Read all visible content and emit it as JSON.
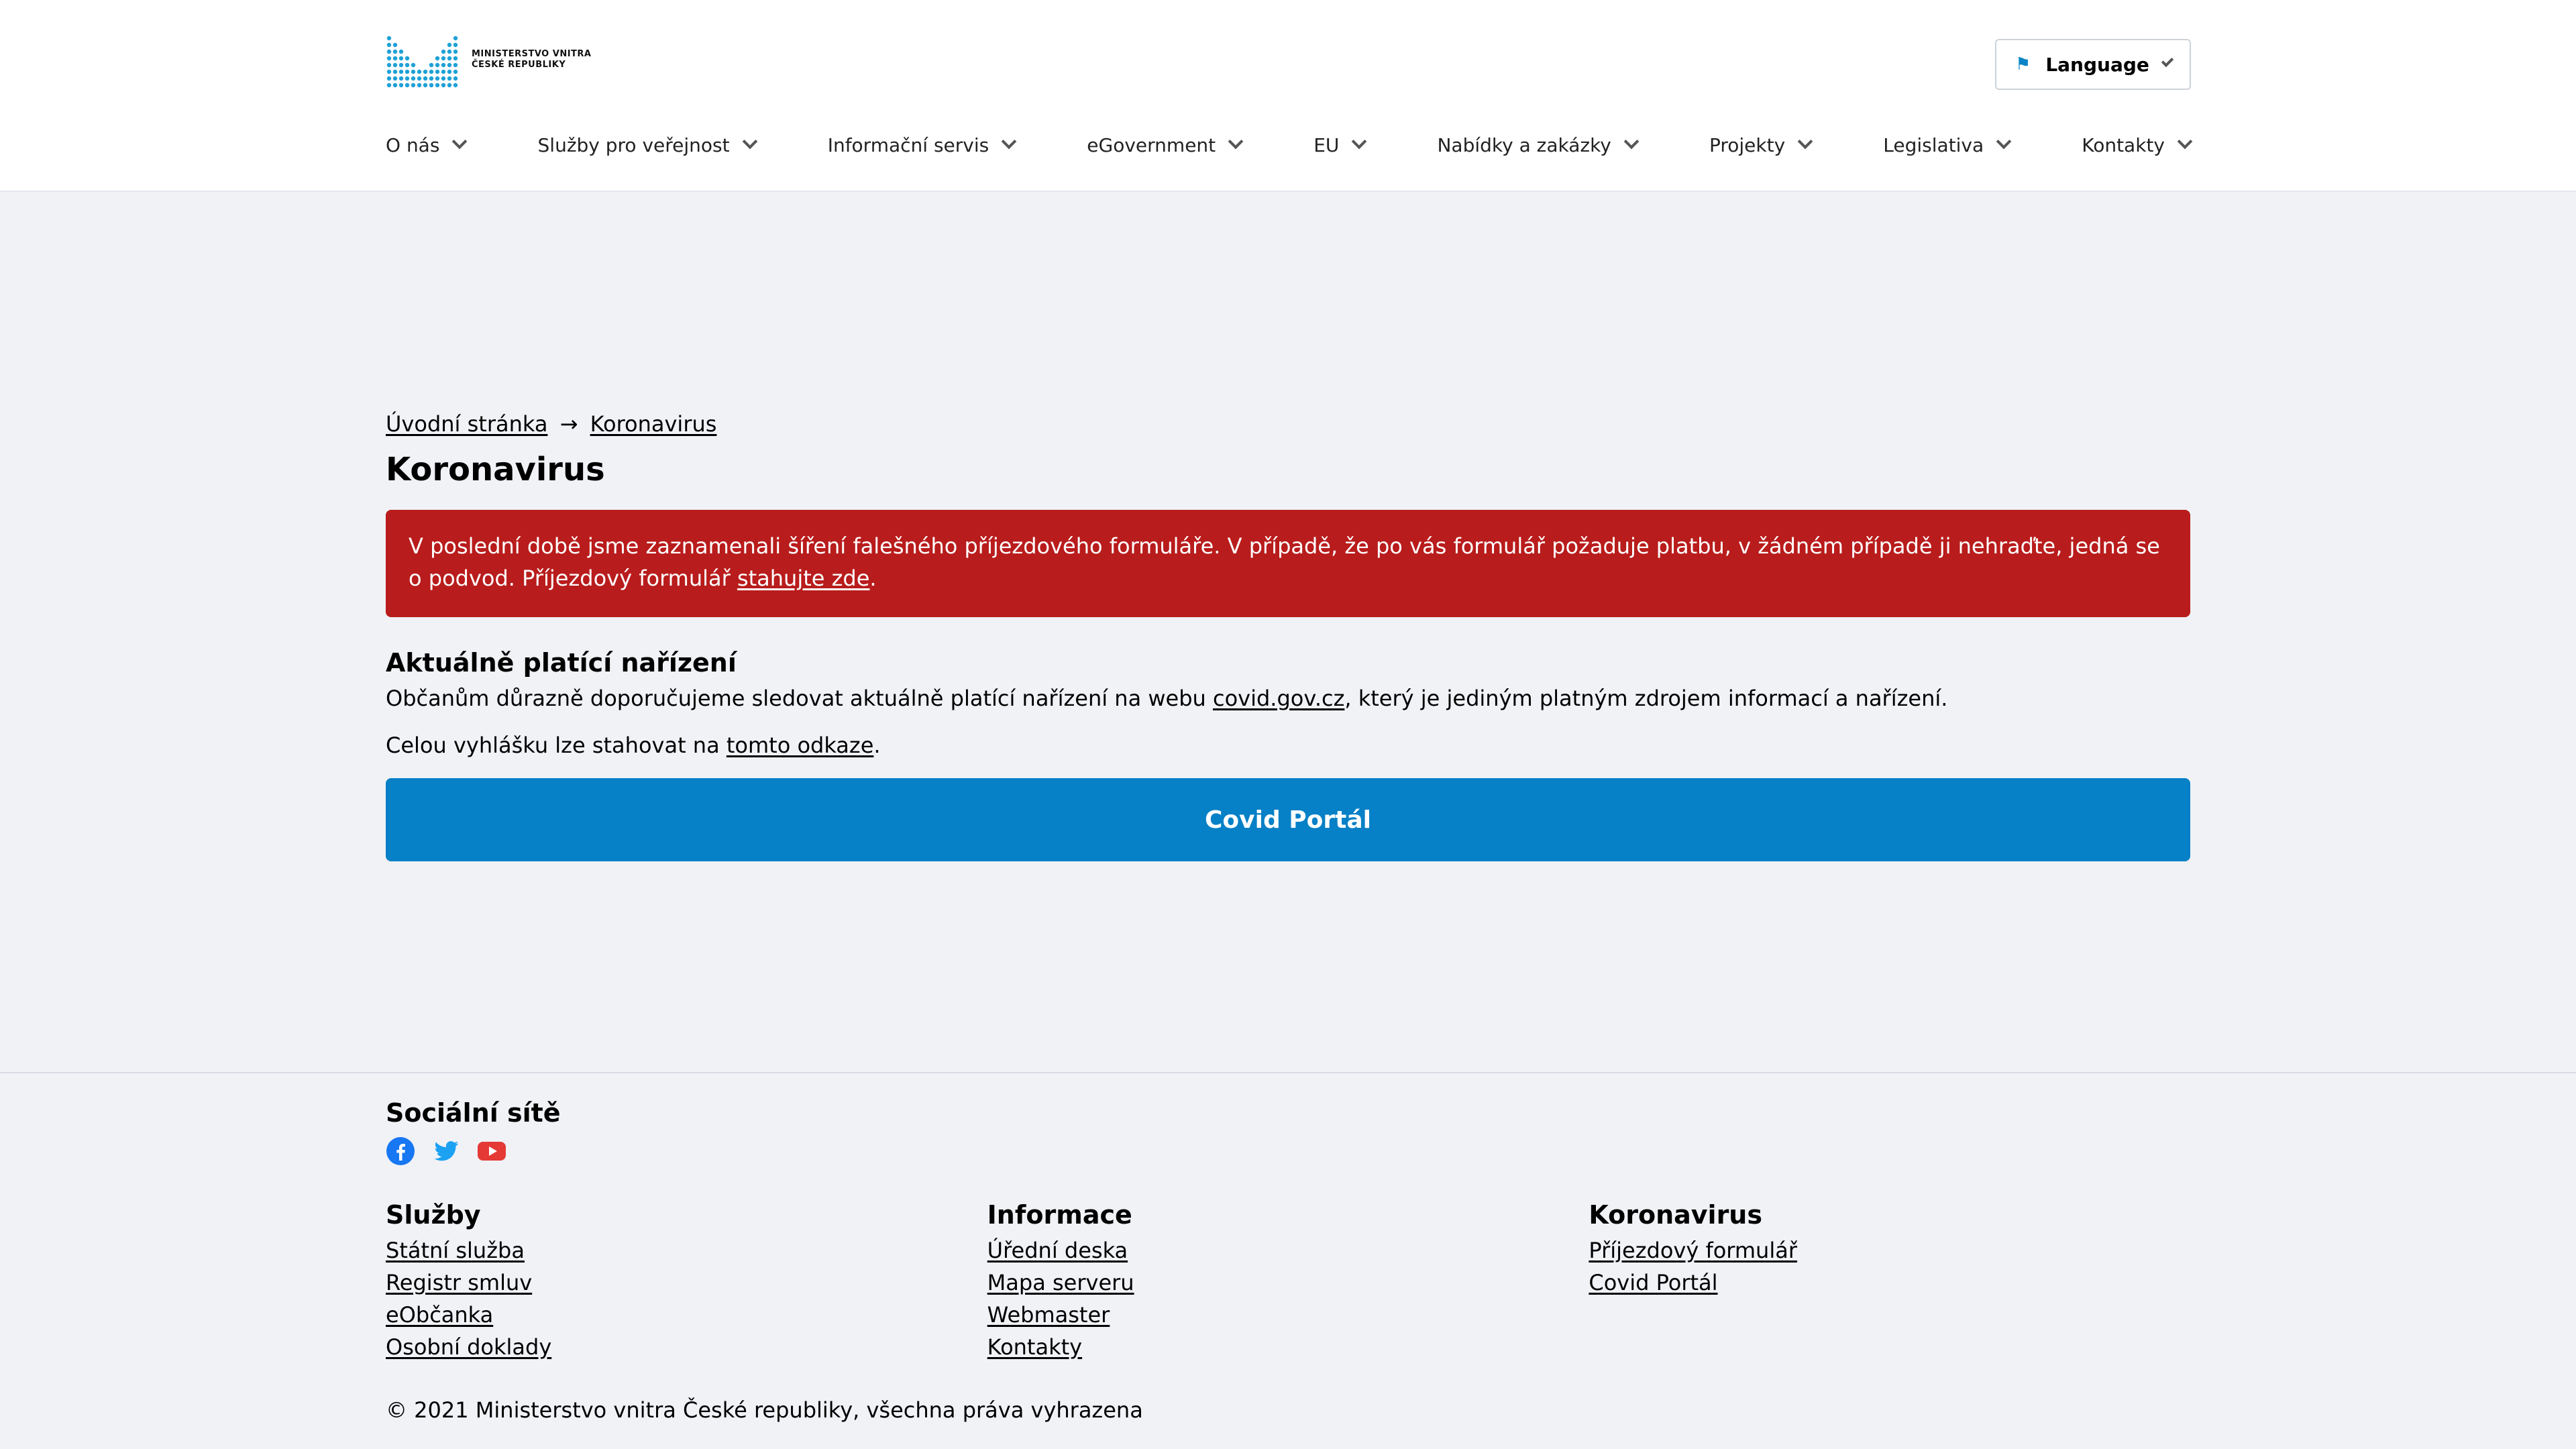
{
  "header": {
    "logo_line1": "MINISTERSTVO VNITRA",
    "logo_line2": "ČESKÉ REPUBLIKY",
    "language_label": "Language",
    "nav": [
      {
        "label": "O nás"
      },
      {
        "label": "Služby pro veřejnost"
      },
      {
        "label": "Informační servis"
      },
      {
        "label": "eGovernment"
      },
      {
        "label": "EU"
      },
      {
        "label": "Nabídky a zakázky"
      },
      {
        "label": "Projekty"
      },
      {
        "label": "Legislativa"
      },
      {
        "label": "Kontakty"
      }
    ]
  },
  "breadcrumb": {
    "home": "Úvodní stránka",
    "separator": "→",
    "current": "Koronavirus"
  },
  "page_title": "Koronavirus",
  "alert": {
    "text_before": "V poslední době jsme zaznamenali šíření falešného příjezdového formuláře. V případě, že po vás formulář požaduje platbu, v žádném případě ji nehraďte, jedná se o podvod. Příjezdový formulář ",
    "link": "stahujte zde",
    "text_after": "."
  },
  "section": {
    "title": "Aktuálně platící nařízení",
    "p1_before": "Občanům důrazně doporučujeme sledovat aktuálně platící nařízení na webu ",
    "p1_link": "covid.gov.cz",
    "p1_after": ", který je jediným platným zdrojem informací a nařízení.",
    "p2_before": "Celou vyhlášku lze stahovat na ",
    "p2_link": "tomto odkaze",
    "p2_after": "."
  },
  "covid_button": "Covid Portál",
  "footer": {
    "social_title": "Sociální sítě",
    "social_icons": [
      "facebook-icon",
      "twitter-icon",
      "youtube-icon"
    ],
    "columns": [
      {
        "title": "Služby",
        "links": [
          "Státní služba",
          "Registr smluv",
          "eObčanka",
          "Osobní doklady"
        ]
      },
      {
        "title": "Informace",
        "links": [
          "Úřední deska",
          "Mapa serveru",
          "Webmaster",
          "Kontakty"
        ]
      },
      {
        "title": "Koronavirus",
        "links": [
          "Příjezdový formulář",
          "Covid Portál"
        ]
      }
    ],
    "copyright": "© 2021 Ministerstvo vnitra České republiky, všechna práva vyhrazena"
  },
  "colors": {
    "accent": "#0680c6",
    "alert": "#b91c1c",
    "facebook": "#1877f2",
    "twitter": "#1da1f2",
    "youtube": "#e53935"
  }
}
